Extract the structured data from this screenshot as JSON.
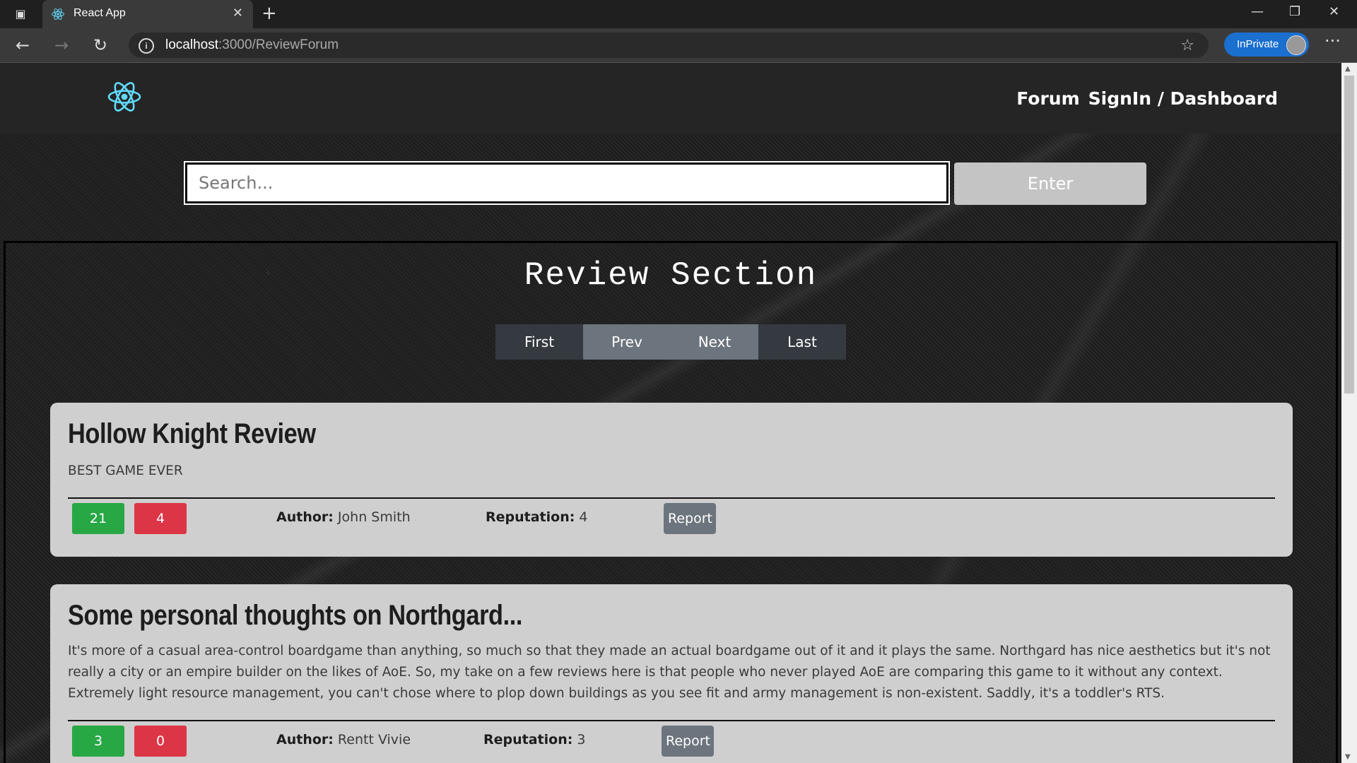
{
  "browser": {
    "tab_title": "React App",
    "tab_close": "✕",
    "new_tab": "+",
    "window_controls": {
      "minimize": "—",
      "restore": "❐",
      "close": "✕"
    },
    "url_host": "localhost",
    "url_path": ":3000/ReviewForum",
    "inprivate_label": "InPrivate",
    "more_label": "···",
    "back": "←",
    "forward": "→",
    "reload": "↻",
    "favorites": "☆",
    "info": "i"
  },
  "navbar": {
    "links": [
      "Forum",
      "SignIn / Dashboard"
    ],
    "logo_color": "#61dafb"
  },
  "search": {
    "placeholder": "Search...",
    "value": "",
    "button_label": "Enter"
  },
  "review_section": {
    "title": "Review Section",
    "pager": [
      "First",
      "Prev",
      "Next",
      "Last"
    ]
  },
  "reviews": [
    {
      "title": "Hollow Knight Review",
      "body": "BEST GAME EVER",
      "upvotes": "21",
      "downvotes": "4",
      "author_label": "Author:",
      "author": "John Smith",
      "reputation_label": "Reputation:",
      "reputation": "4",
      "report_label": "Report"
    },
    {
      "title": "Some personal thoughts on Northgard...",
      "body": "It's more of a casual area-control boardgame than anything, so much so that they made an actual boardgame out of it and it plays the same. Northgard has nice aesthetics but it's not really a city or an empire builder on the likes of AoE. So, my take on a few reviews here is that people who never played AoE are comparing this game to it without any context. Extremely light resource management, you can't chose where to plop down buildings as you see fit and army management is non-existent. Saddly, it's a toddler's RTS.",
      "upvotes": "3",
      "downvotes": "0",
      "author_label": "Author:",
      "author": "Rentt Vivie",
      "reputation_label": "Reputation:",
      "reputation": "3",
      "report_label": "Report"
    }
  ],
  "colors": {
    "upvote": "#28a745",
    "downvote": "#dc3545",
    "report": "#6c757d",
    "inprivate": "#1a6fcf"
  }
}
